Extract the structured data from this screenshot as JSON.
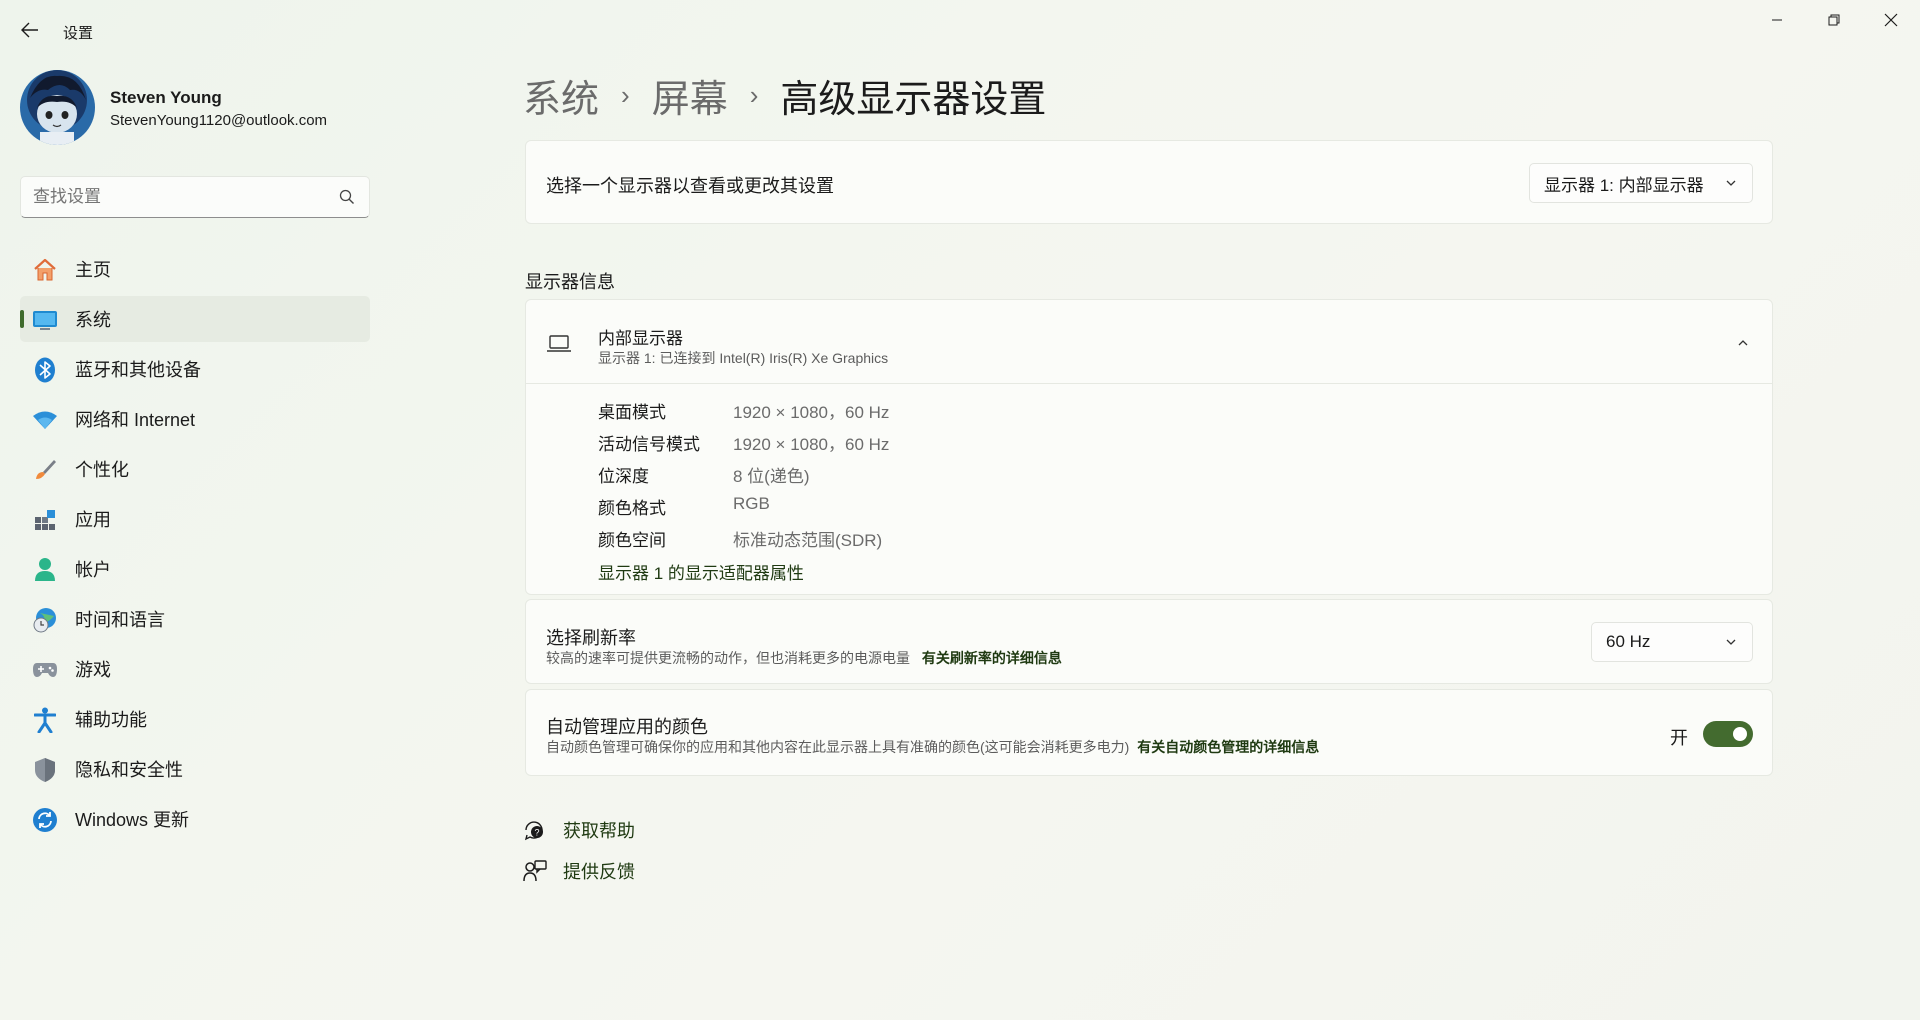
{
  "window": {
    "title": "设置",
    "back_icon": "arrow-left-icon",
    "controls": [
      "minimize-icon",
      "restore-icon",
      "close-icon"
    ]
  },
  "profile": {
    "name": "Steven Young",
    "email": "StevenYoung1120@outlook.com"
  },
  "search": {
    "placeholder": "查找设置",
    "icon": "search-icon"
  },
  "sidebar": {
    "items": [
      {
        "label": "主页",
        "icon": "home-icon",
        "active": false
      },
      {
        "label": "系统",
        "icon": "monitor-icon",
        "active": true
      },
      {
        "label": "蓝牙和其他设备",
        "icon": "bluetooth-icon",
        "active": false
      },
      {
        "label": "网络和 Internet",
        "icon": "wifi-icon",
        "active": false
      },
      {
        "label": "个性化",
        "icon": "brush-icon",
        "active": false
      },
      {
        "label": "应用",
        "icon": "apps-icon",
        "active": false
      },
      {
        "label": "帐户",
        "icon": "account-icon",
        "active": false
      },
      {
        "label": "时间和语言",
        "icon": "globe-clock-icon",
        "active": false
      },
      {
        "label": "游戏",
        "icon": "gamepad-icon",
        "active": false
      },
      {
        "label": "辅助功能",
        "icon": "accessibility-icon",
        "active": false
      },
      {
        "label": "隐私和安全性",
        "icon": "shield-icon",
        "active": false
      },
      {
        "label": "Windows 更新",
        "icon": "update-icon",
        "active": false
      }
    ]
  },
  "breadcrumb": {
    "items": [
      "系统",
      "屏幕"
    ],
    "separator": "›",
    "current": "高级显示器设置"
  },
  "display_select": {
    "label": "选择一个显示器以查看或更改其设置",
    "selected": "显示器 1: 内部显示器"
  },
  "display_info": {
    "section_title": "显示器信息",
    "name": "内部显示器",
    "subtitle": "显示器 1: 已连接到 Intel(R) Iris(R) Xe Graphics",
    "rows": [
      {
        "key": "桌面模式",
        "value": "1920 × 1080，60 Hz"
      },
      {
        "key": "活动信号模式",
        "value": "1920 × 1080，60 Hz"
      },
      {
        "key": "位深度",
        "value": "8 位(递色)"
      },
      {
        "key": "颜色格式",
        "value": "RGB"
      },
      {
        "key": "颜色空间",
        "value": "标准动态范围(SDR)"
      }
    ],
    "adapter_link": "显示器 1 的显示适配器属性"
  },
  "refresh_rate": {
    "label": "选择刷新率",
    "desc": "较高的速率可提供更流畅的动作，但也消耗更多的电源电量",
    "link": "有关刷新率的详细信息",
    "selected": "60 Hz"
  },
  "color_mgmt": {
    "label": "自动管理应用的颜色",
    "desc": "自动颜色管理可确保你的应用和其他内容在此显示器上具有准确的颜色(这可能会消耗更多电力)",
    "link": "有关自动颜色管理的详细信息",
    "state_label": "开",
    "enabled": true
  },
  "help": {
    "get_help": "获取帮助",
    "feedback": "提供反馈"
  },
  "colors": {
    "accent": "#436b2f",
    "link": "#1f3a12",
    "sidebar_active_bg": "#e6ebe2"
  }
}
